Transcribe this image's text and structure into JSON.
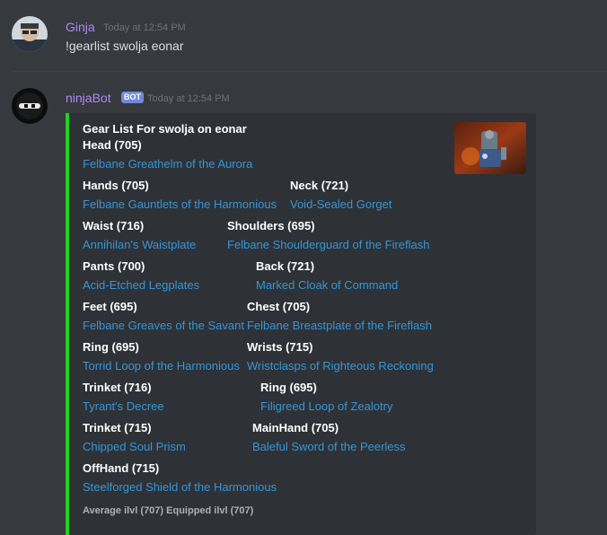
{
  "message1": {
    "username": "Ginja",
    "timestamp": "Today at 12:54 PM",
    "text": "!gearlist swolja eonar"
  },
  "message2": {
    "username": "ninjaBot",
    "bot_tag": "BOT",
    "timestamp": "Today at 12:54 PM"
  },
  "embed": {
    "accent_color": "#1ed41e",
    "title": "Gear List For swolja on eonar",
    "fields": [
      {
        "name": "Head (705)",
        "value": "Felbane Greathelm of the Aurora"
      },
      {
        "name": "Hands (705)",
        "value": "Felbane Gauntlets of the Harmonious"
      },
      {
        "name": "Neck (721)",
        "value": "Void-Sealed Gorget"
      },
      {
        "name": "Waist (716)",
        "value": "Annihilan's Waistplate"
      },
      {
        "name": "Shoulders (695)",
        "value": "Felbane Shoulderguard of the Fireflash"
      },
      {
        "name": "Pants (700)",
        "value": "Acid-Etched Legplates"
      },
      {
        "name": "Back (721)",
        "value": "Marked Cloak of Command"
      },
      {
        "name": "Feet (695)",
        "value": "Felbane Greaves of the Savant"
      },
      {
        "name": "Chest (705)",
        "value": "Felbane Breastplate of the Fireflash"
      },
      {
        "name": "Ring (695)",
        "value": "Torrid Loop of the Harmonious"
      },
      {
        "name": "Wrists (715)",
        "value": "Wristclasps of Righteous Reckoning"
      },
      {
        "name": "Trinket (716)",
        "value": "Tyrant's Decree"
      },
      {
        "name": "Ring (695)",
        "value": "Filigreed Loop of Zealotry"
      },
      {
        "name": "Trinket (715)",
        "value": "Chipped Soul Prism"
      },
      {
        "name": "MainHand (705)",
        "value": "Baleful Sword of the Peerless"
      },
      {
        "name": "OffHand (715)",
        "value": "Steelforged Shield of the Harmonious"
      }
    ],
    "footer": "Average ilvl (707) Equipped ilvl (707)"
  }
}
